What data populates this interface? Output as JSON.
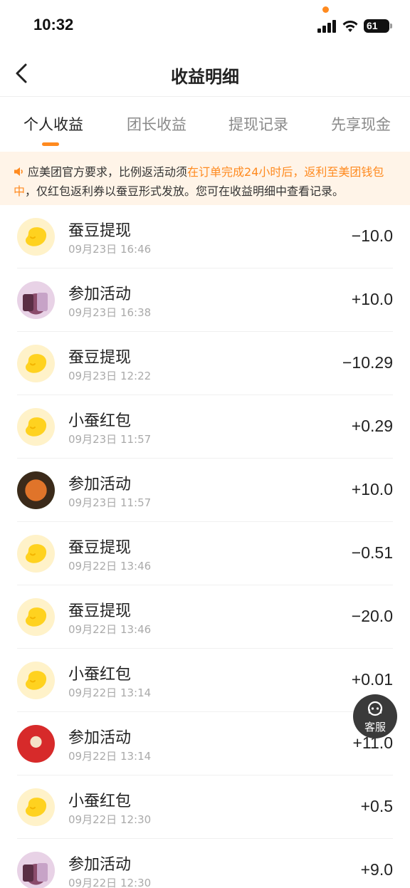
{
  "status": {
    "time": "10:32",
    "battery": "61"
  },
  "nav": {
    "title": "收益明细"
  },
  "tabs": [
    {
      "label": "个人收益",
      "active": true
    },
    {
      "label": "团长收益",
      "active": false
    },
    {
      "label": "提现记录",
      "active": false
    },
    {
      "label": "先享现金",
      "active": false
    }
  ],
  "notice": {
    "part1": "应美团官方要求，比例返活动须",
    "highlight": "在订单完成24小时后，返利至美团钱包中",
    "part2": "，仅红包返利券以蚕豆形式发放。您可在收益明细中查看记录。"
  },
  "records": [
    {
      "icon": "bean-icon",
      "title": "蚕豆提现",
      "time": "09月23日 16:46",
      "amount": "−10.0"
    },
    {
      "icon": "milk-tea-image",
      "title": "参加活动",
      "time": "09月23日 16:38",
      "amount": "+10.0"
    },
    {
      "icon": "bean-icon",
      "title": "蚕豆提现",
      "time": "09月23日 12:22",
      "amount": "−10.29"
    },
    {
      "icon": "bean-icon",
      "title": "小蚕红包",
      "time": "09月23日 11:57",
      "amount": "+0.29"
    },
    {
      "icon": "food-image",
      "title": "参加活动",
      "time": "09月23日 11:57",
      "amount": "+10.0"
    },
    {
      "icon": "bean-icon",
      "title": "蚕豆提现",
      "time": "09月22日 13:46",
      "amount": "−0.51"
    },
    {
      "icon": "bean-icon",
      "title": "蚕豆提现",
      "time": "09月22日 13:46",
      "amount": "−20.0"
    },
    {
      "icon": "bean-icon",
      "title": "小蚕红包",
      "time": "09月22日 13:14",
      "amount": "+0.01"
    },
    {
      "icon": "promo-image",
      "title": "参加活动",
      "time": "09月22日 13:14",
      "amount": "+11.0"
    },
    {
      "icon": "bean-icon",
      "title": "小蚕红包",
      "time": "09月22日 12:30",
      "amount": "+0.5"
    },
    {
      "icon": "milk-tea-image",
      "title": "参加活动",
      "time": "09月22日 12:30",
      "amount": "+9.0"
    }
  ],
  "service": {
    "label": "客服"
  },
  "colors": {
    "accent": "#ff8a1f",
    "notice_bg": "#fff4e8",
    "bean": "#ffd21f"
  }
}
